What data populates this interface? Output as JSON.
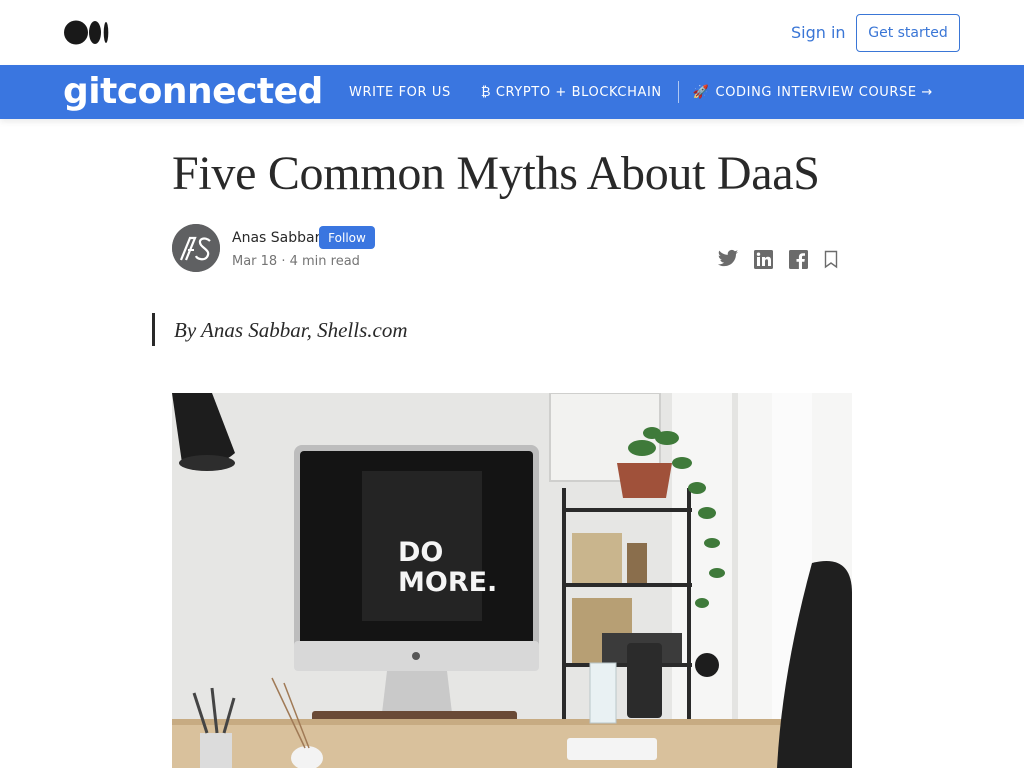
{
  "header": {
    "logo_icon": "medium-logo-icon",
    "signin_label": "Sign in",
    "get_started_label": "Get started"
  },
  "publication": {
    "logo_text": "gitconnected",
    "nav": {
      "write_for_us": "WRITE FOR US",
      "crypto": "₿ CRYPTO + BLOCKCHAIN",
      "coding_course": "CODING INTERVIEW COURSE →"
    },
    "bar_color": "#3a76e0"
  },
  "article": {
    "title": "Five Common Myths About DaaS",
    "author": {
      "name": "Anas Sabbar",
      "initials": "AS",
      "follow_label": "Follow"
    },
    "date": "Mar 18",
    "read_time": "4 min read",
    "byline_quote": "By Anas Sabbar, Shells.com",
    "hero_screen_text": [
      "DO",
      "MORE."
    ]
  },
  "share_icons": [
    "twitter-icon",
    "linkedin-icon",
    "facebook-icon",
    "bookmark-icon"
  ],
  "colors": {
    "accent": "#3a76d6",
    "text": "#292929",
    "muted": "#757575"
  }
}
